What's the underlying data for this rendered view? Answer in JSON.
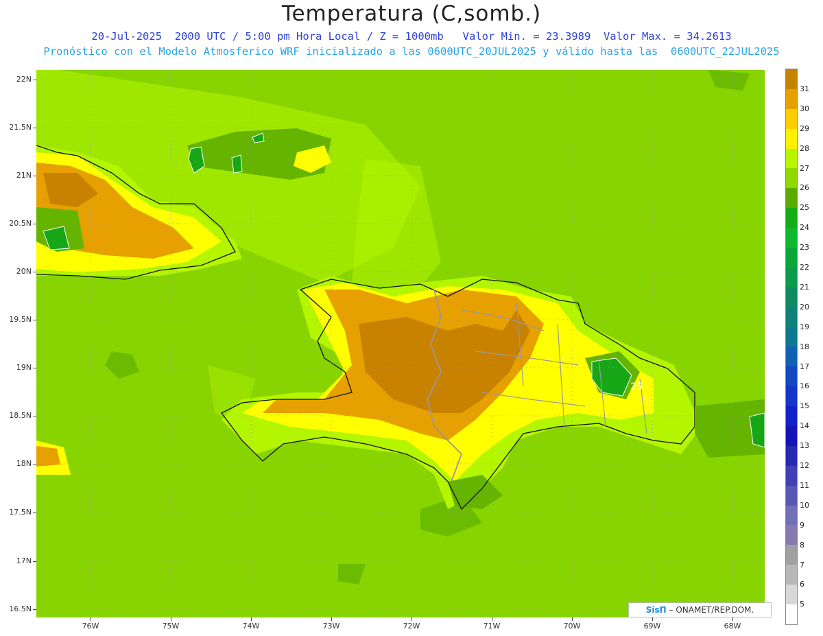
{
  "header": {
    "title": "Temperatura (C,somb.)",
    "line1": "20-Jul-2025  2000 UTC / 5:00 pm Hora Local / Z = 1000mb   Valor Min. = 23.3989  Valor Max. = 34.2613",
    "line2": "Pronóstico con el Modelo Atmosferico WRF inicializado a las 0600UTC_20JUL2025 y válido hasta las  0600UTC_22JUL2025"
  },
  "map": {
    "lat_labels": [
      "22N",
      "21.5N",
      "21N",
      "20.5N",
      "20N",
      "19.5N",
      "19N",
      "18.5N",
      "18N",
      "17.5N",
      "17N",
      "16.5N"
    ],
    "lon_labels": [
      "76W",
      "75W",
      "74W",
      "73W",
      "72W",
      "71W",
      "70W",
      "69W",
      "68W"
    ],
    "contour_label": "25",
    "colors": {
      "c24": "#16a616",
      "c25": "#64b400",
      "c26": "#8cd800",
      "c27": "#b4f500",
      "c28": "#ffff00",
      "c29": "#ffc800",
      "c30": "#e6a000",
      "c31": "#c88200"
    }
  },
  "colorbar": {
    "labels": [
      "31",
      "30",
      "29",
      "28",
      "27",
      "26",
      "25",
      "24",
      "23",
      "22",
      "21",
      "20",
      "19",
      "18",
      "17",
      "16",
      "15",
      "14",
      "13",
      "12",
      "11",
      "10",
      "9",
      "8",
      "7",
      "6",
      "5"
    ],
    "colors": [
      "#c38400",
      "#e6a000",
      "#ffcc00",
      "#fff000",
      "#b8f500",
      "#8fd800",
      "#5aaa00",
      "#16ac16",
      "#10b830",
      "#0aa63a",
      "#0c9a4c",
      "#0e8c60",
      "#0e8278",
      "#0e7890",
      "#1060b4",
      "#1248c0",
      "#1436c8",
      "#1222c8",
      "#1414b4",
      "#2828b4",
      "#4040b4",
      "#5858b4",
      "#7070b4",
      "#8878b0",
      "#a0a0a0",
      "#b8b8b8",
      "#d8d8d8",
      "#ffffff"
    ]
  },
  "credit": {
    "brand": "SisΠ",
    "org": " –  ONAMET/REP.DOM."
  }
}
